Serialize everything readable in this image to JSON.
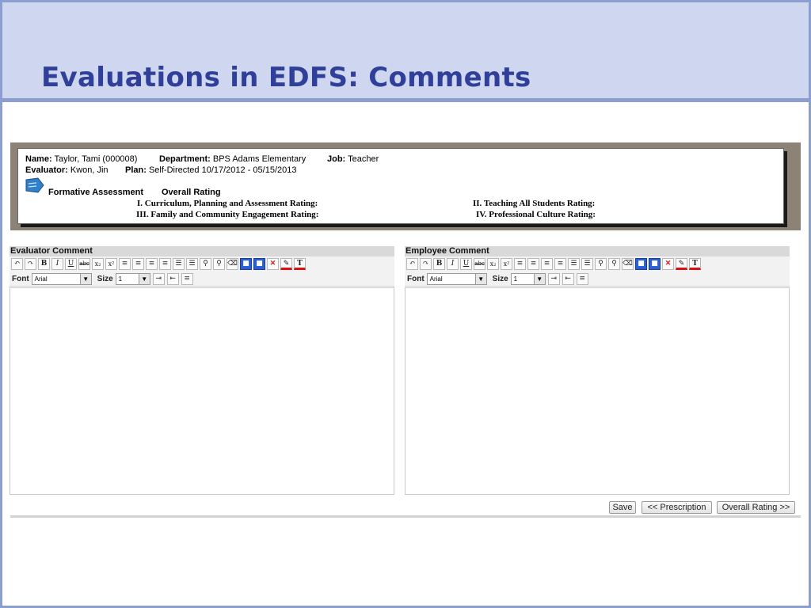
{
  "slide": {
    "title": "Evaluations in EDFS: Comments"
  },
  "info": {
    "name_label": "Name:",
    "name_value": "Taylor, Tami (000008)",
    "department_label": "Department:",
    "department_value": "BPS Adams Elementary",
    "job_label": "Job:",
    "job_value": "Teacher",
    "evaluator_label": "Evaluator:",
    "evaluator_value": "Kwon, Jin",
    "plan_label": "Plan:",
    "plan_value": "Self-Directed 10/17/2012 - 05/15/2013",
    "formative": "Formative Assessment",
    "overall": "Overall Rating",
    "rating1": "I. Curriculum, Planning and Assessment Rating:",
    "rating2": "II. Teaching All Students Rating:",
    "rating3": "III. Family and Community Engagement Rating:",
    "rating4": "IV. Professional Culture Rating:"
  },
  "panels": {
    "evaluator": {
      "header": "Evaluator Comment"
    },
    "employee": {
      "header": "Employee Comment"
    }
  },
  "toolbar": {
    "undo": "↶",
    "redo": "↷",
    "bold": "B",
    "italic": "I",
    "underline": "U",
    "strike": "abc",
    "sub": "x₂",
    "sup": "x²",
    "delete": "✕",
    "text_color": "T",
    "font_label": "Font",
    "font_value": "Arial",
    "size_label": "Size",
    "size_value": "1",
    "dropdown_arrow": "▼"
  },
  "buttons": {
    "save": "Save",
    "prescription": "<< Prescription",
    "overall_rating": "Overall Rating >>"
  },
  "colors": {
    "title": "#30409a",
    "band": "#cfd6ef",
    "frame": "#8a9fd0"
  }
}
